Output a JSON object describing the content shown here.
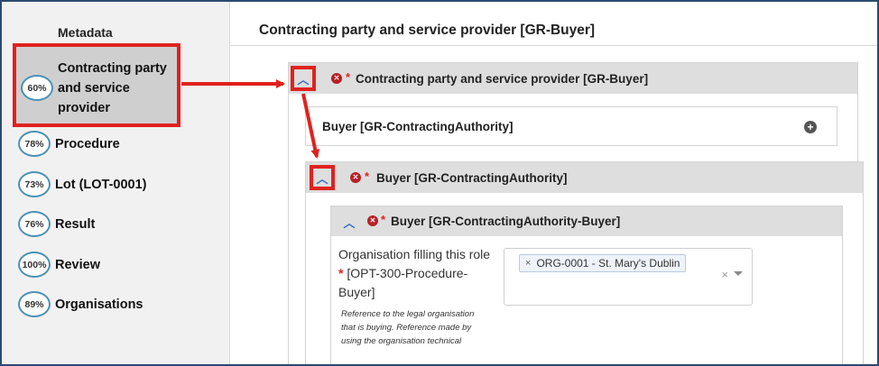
{
  "sidebar": {
    "header": "Metadata",
    "items": [
      {
        "percent": "60%",
        "label": "Contracting party and service provider",
        "active": true
      },
      {
        "percent": "78%",
        "label": "Procedure"
      },
      {
        "percent": "73%",
        "label": "Lot (LOT-0001)"
      },
      {
        "percent": "76%",
        "label": "Result"
      },
      {
        "percent": "100%",
        "label": "Review"
      },
      {
        "percent": "89%",
        "label": "Organisations"
      }
    ]
  },
  "main": {
    "title": "Contracting party and service provider [GR-Buyer]",
    "section": {
      "label": "Contracting party and service provider  [GR-Buyer]",
      "required_mark": "*",
      "add_box_label": "Buyer  [GR-ContractingAuthority]",
      "subsection": {
        "label": "Buyer  [GR-ContractingAuthority]",
        "required_mark": "*",
        "group": {
          "label": "Buyer  [GR-ContractingAuthority-Buyer]",
          "required_mark": "*",
          "field": {
            "label_before": "Organisation filling this role",
            "required_mark": "*",
            "label_after": "[OPT-300-Procedure-Buyer]",
            "help": "Reference to the legal organisation that is buying. Reference made by using the organisation technical",
            "selected_value": "ORG-0001 - St. Mary's Dublin",
            "chip_remove": "×",
            "clear": "×"
          }
        }
      }
    }
  },
  "icons": {
    "chevron_up": "chevron-up-icon",
    "error": "error-circle-icon",
    "add": "plus-circle-icon",
    "dropdown": "caret-down-icon"
  },
  "colors": {
    "highlight_red": "#e0221f",
    "error_red": "#b82025",
    "chevron_blue": "#3a6fc1",
    "badge_ring": "#4c91b2",
    "frame_border": "#2b4a6f"
  }
}
